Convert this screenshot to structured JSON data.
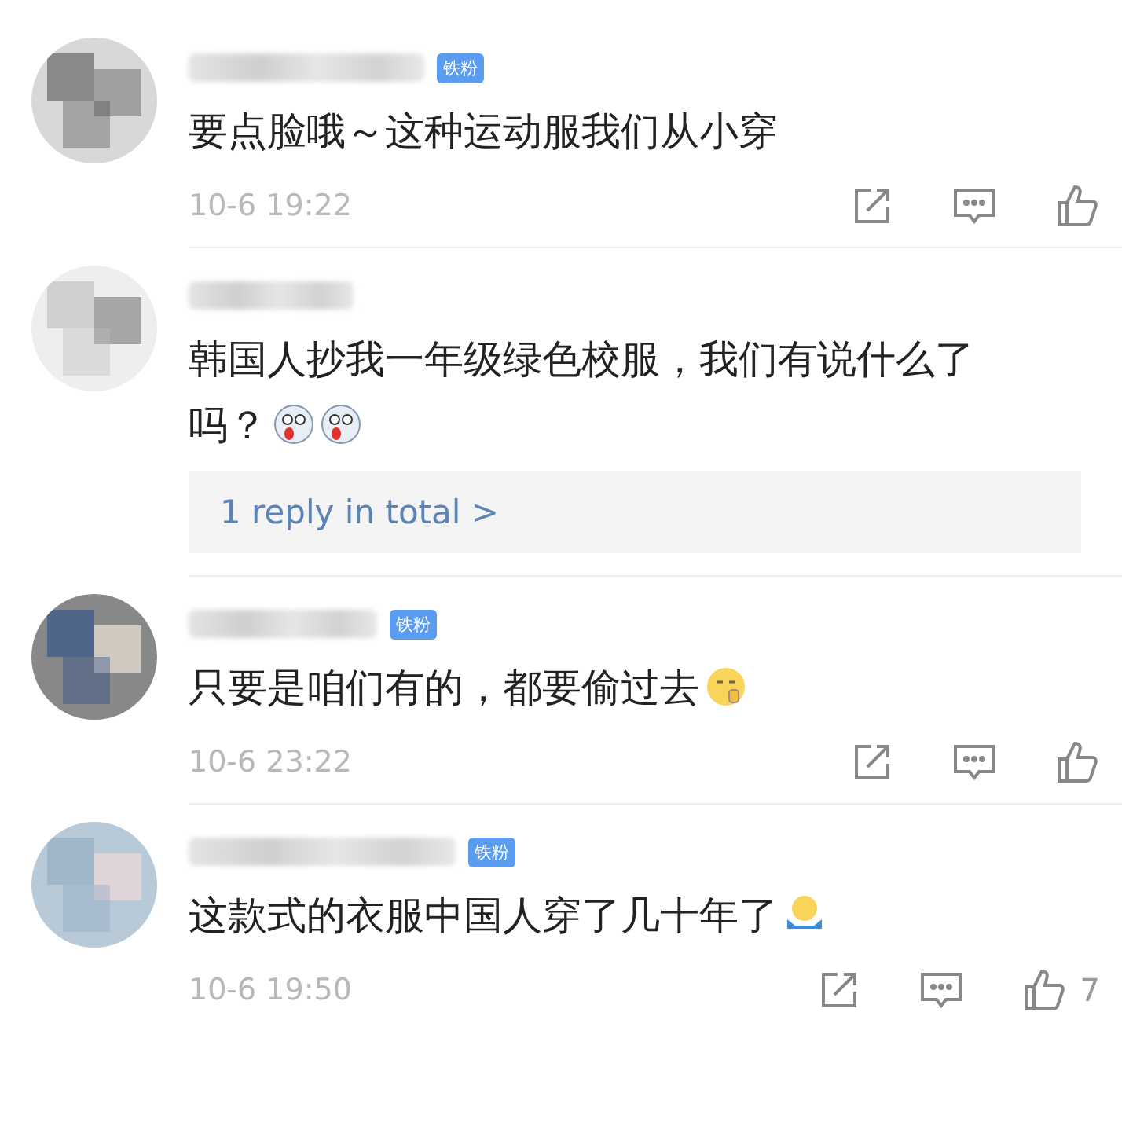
{
  "comments": [
    {
      "badge": "铁粉",
      "text": "要点脸哦～这种运动服我们从小穿",
      "time": "10-6 19:22"
    },
    {
      "text": "韩国人抄我一年级绿色校服，我们有说什么了吗？",
      "emojis": [
        {
          "kind": "drool"
        },
        {
          "kind": "drool"
        }
      ],
      "replies_link": "1 reply in total >"
    },
    {
      "badge": "铁粉",
      "text": "只要是咱们有的，都要偷过去",
      "emojis": [
        {
          "kind": "shush"
        }
      ],
      "time": "10-6 23:22"
    },
    {
      "badge": "铁粉",
      "text": "这款式的衣服中国人穿了几十年了",
      "emojis": [
        {
          "kind": "shrug"
        }
      ],
      "time": "10-6 19:50",
      "likes": "7"
    }
  ]
}
